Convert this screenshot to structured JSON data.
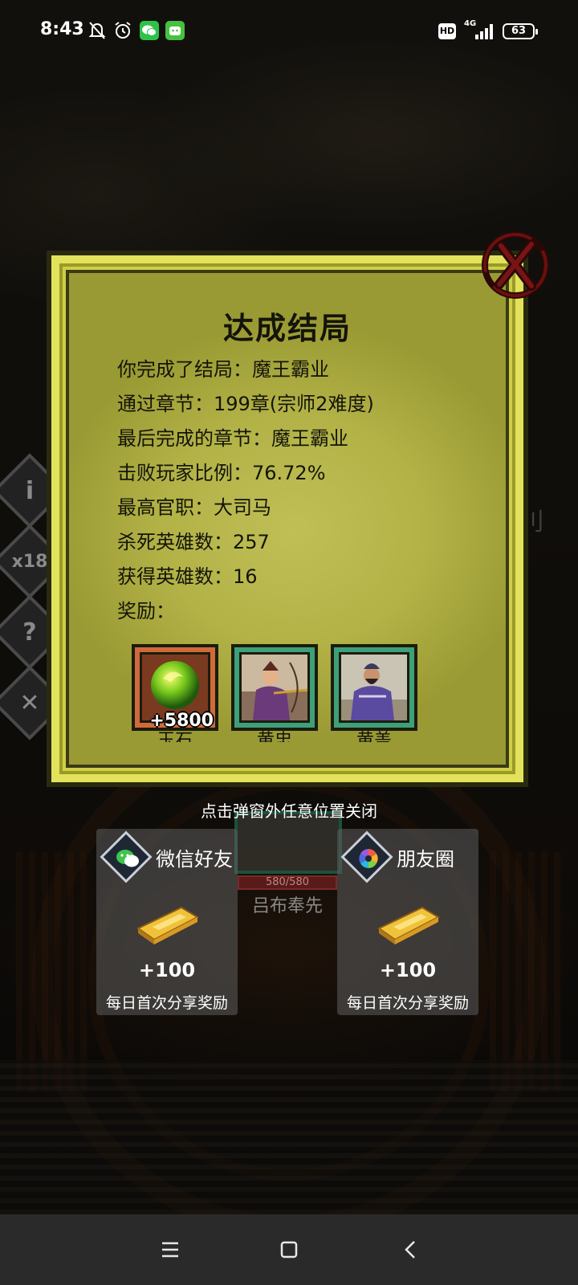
{
  "status_bar": {
    "time": "8:43",
    "network": "4G",
    "battery": "63",
    "hd_badge": "HD",
    "icons": [
      "mute-bell-icon",
      "alarm-icon",
      "wechat-icon",
      "app-notification-icon"
    ]
  },
  "background": {
    "hero_hp": "580/580",
    "hero_name": "吕布奉先",
    "side_multiplier": "x18",
    "side_icons": [
      "info-icon",
      "speed-icon",
      "help-icon",
      "close-icon"
    ]
  },
  "dialog": {
    "title": "达成结局",
    "lines": [
      "你完成了结局：魔王霸业",
      "通过章节：199章(宗师2难度)",
      "最后完成的章节：魔王霸业",
      "击败玩家比例：76.72%",
      "最高官职：大司马",
      "杀死英雄数：257",
      "获得英雄数：16",
      "奖励："
    ],
    "rewards": [
      {
        "amount": "+5800",
        "caption": "玉石",
        "frame": "gold",
        "icon": "jade-orb-icon"
      },
      {
        "amount": "",
        "caption": "黄忠",
        "frame": "green",
        "icon": "hero-archer-portrait"
      },
      {
        "amount": "",
        "caption": "黄盖",
        "frame": "green",
        "icon": "hero-general-portrait"
      }
    ],
    "close_icon": "close-x-icon"
  },
  "hint": "点击弹窗外任意位置关闭",
  "share": [
    {
      "label": "微信好友",
      "value": "+100",
      "desc": "每日首次分享奖励",
      "icon": "wechat-icon"
    },
    {
      "label": "朋友圈",
      "value": "+100",
      "desc": "每日首次分享奖励",
      "icon": "moments-icon"
    }
  ],
  "colors": {
    "panel": "#cfcf45",
    "paper": "#b2b247",
    "reward_gold_frame": "#d06a3c",
    "reward_green_frame": "#3ea07a"
  }
}
